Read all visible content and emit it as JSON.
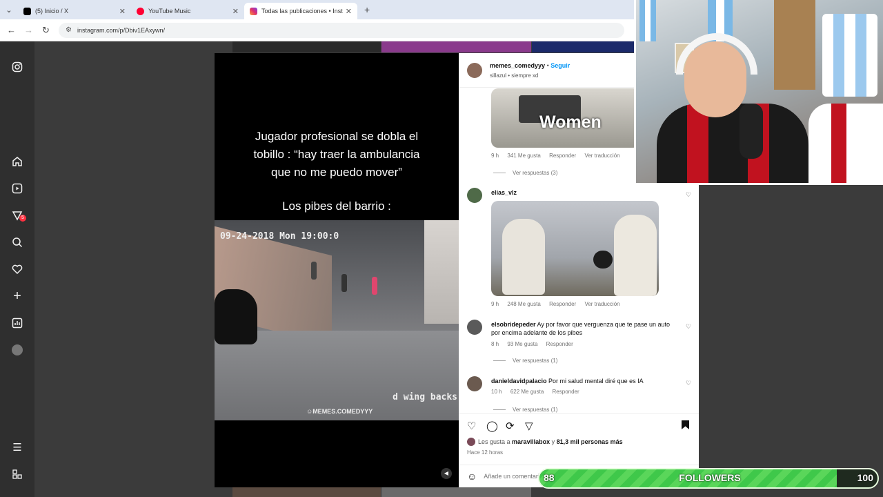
{
  "browser": {
    "tabs": [
      {
        "title": "(5) Inicio / X",
        "favicon_color": "#000000"
      },
      {
        "title": "YouTube Music",
        "favicon_color": "#ff0033"
      },
      {
        "title": "Todas las publicaciones • Instag",
        "favicon_color": "#e1306c"
      }
    ],
    "url": "instagram.com/p/Dbiv1EAxywn/"
  },
  "sidebar": {
    "icons": [
      "instagram-icon",
      "home-icon",
      "reels-icon",
      "explore-icon",
      "search-icon",
      "notifications-icon",
      "create-icon",
      "dashboard-icon",
      "profile-icon",
      "menu-icon",
      "more-apps-icon"
    ],
    "badge_count": "5"
  },
  "video": {
    "caption_lines": [
      "Jugador profesional se dobla el",
      "tobillo : “hay traer la ambulancia",
      "que no me puedo mover”"
    ],
    "caption_bottom": "Los pibes del barrio :",
    "timestamp": "09-24-2018 Mon 19:00:0",
    "overlay_text": "d wing backs",
    "watermark": "☺MEMES.COMEDYYY"
  },
  "post": {
    "author": "memes_comedyyy",
    "follow_label": "Seguir",
    "subtitle": "sillazul • siempre xd",
    "gif1_text": "Women",
    "c1_meta": {
      "time": "9 h",
      "likes": "341 Me gusta",
      "reply": "Responder",
      "translate": "Ver traducción"
    },
    "c1_replies": "Ver respuestas (3)",
    "c2_user": "elias_vlz",
    "c2_meta": {
      "time": "9 h",
      "likes": "248 Me gusta",
      "reply": "Responder",
      "translate": "Ver traducción"
    },
    "c3_user": "elsobridepeder",
    "c3_text": "Ay por favor que verguenza que te pase un auto por encima adelante de los pibes",
    "c3_meta": {
      "time": "8 h",
      "likes": "93 Me gusta",
      "reply": "Responder"
    },
    "c3_replies": "Ver respuestas (1)",
    "c4_user": "danieldavidpalacio",
    "c4_text": "Por mi salud mental diré que es IA",
    "c4_meta": {
      "time": "10 h",
      "likes": "622 Me gusta",
      "reply": "Responder"
    },
    "c4_replies": "Ver respuestas (1)",
    "likes_prefix": "Les gusta a ",
    "likes_user": "maravillabox",
    "likes_mid": " y ",
    "likes_count": "81,3 mil personas más",
    "time_ago": "Hace 12 horas",
    "comment_placeholder": "Añade un comentario..."
  },
  "followers_goal": {
    "current": "88",
    "label": "FOLLOWERS",
    "goal": "100",
    "progress": 0.88
  }
}
